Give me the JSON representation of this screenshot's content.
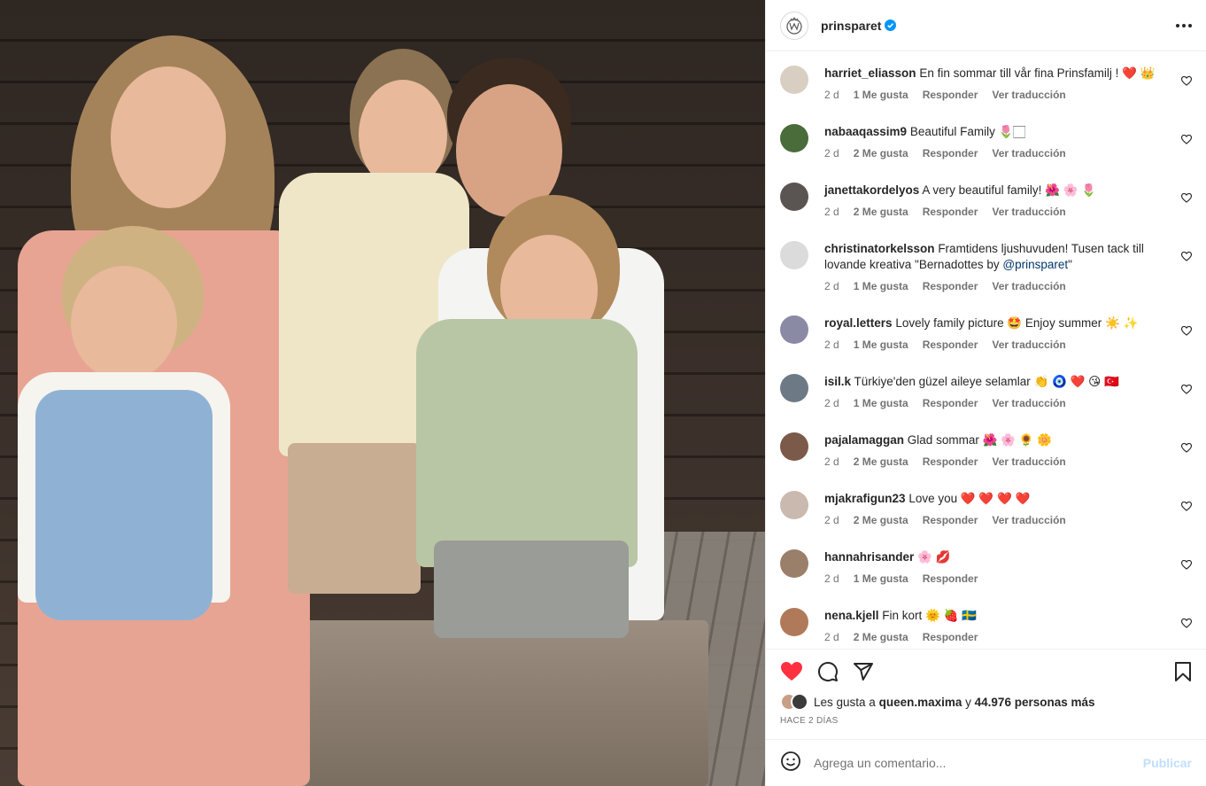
{
  "post": {
    "username": "prinsparet",
    "verified": true,
    "photo_alt": "Family photo"
  },
  "comments": [
    {
      "user": "harriet_eliasson",
      "text": "En fin sommar till vår fina Prinsfamilj ! ❤️ 👑",
      "age": "2 d",
      "likes": "1 Me gusta",
      "reply": "Responder",
      "translate": "Ver traducción",
      "avatar_color": "#d8cfc2"
    },
    {
      "user": "nabaaqassim9",
      "text": "Beautiful Family 🌷🏻",
      "age": "2 d",
      "likes": "2 Me gusta",
      "reply": "Responder",
      "translate": "Ver traducción",
      "avatar_color": "#4a6b3a"
    },
    {
      "user": "janettakordelyos",
      "text": "A very beautiful family! 🌺 🌸 🌷",
      "age": "2 d",
      "likes": "2 Me gusta",
      "reply": "Responder",
      "translate": "Ver traducción",
      "avatar_color": "#5a5552"
    },
    {
      "user": "christinatorkelsson",
      "text": "Framtidens ljushuvuden! Tusen tack till lovande kreativa \"Bernadottes by ",
      "mention": "@prinsparet",
      "text_end": "\"",
      "age": "2 d",
      "likes": "1 Me gusta",
      "reply": "Responder",
      "translate": "Ver traducción",
      "avatar_color": "#dbdbdb"
    },
    {
      "user": "royal.letters",
      "text": "Lovely family picture 🤩 Enjoy summer ☀️ ✨",
      "age": "2 d",
      "likes": "1 Me gusta",
      "reply": "Responder",
      "translate": "Ver traducción",
      "avatar_color": "#8a8aa5"
    },
    {
      "user": "isil.k",
      "text": "Türkiye'den güzel aileye selamlar 👏 🧿 ❤️ 😘 🇹🇷",
      "age": "2 d",
      "likes": "1 Me gusta",
      "reply": "Responder",
      "translate": "Ver traducción",
      "avatar_color": "#6d7a86"
    },
    {
      "user": "pajalamaggan",
      "text": "Glad sommar 🌺 🌸 🌻 🌼",
      "age": "2 d",
      "likes": "2 Me gusta",
      "reply": "Responder",
      "translate": "Ver traducción",
      "avatar_color": "#7b5a4a"
    },
    {
      "user": "mjakrafigun23",
      "text": "Love you ❤️ ❤️ ❤️ ❤️",
      "age": "2 d",
      "likes": "2 Me gusta",
      "reply": "Responder",
      "translate": "Ver traducción",
      "avatar_color": "#c9b9ae"
    },
    {
      "user": "hannahrisander",
      "text": "🌸 💋",
      "age": "2 d",
      "likes": "1 Me gusta",
      "reply": "Responder",
      "translate": "",
      "avatar_color": "#9a7f6b"
    },
    {
      "user": "nena.kjell",
      "text": "Fin kort 🌞 🍓 🇸🇪",
      "age": "2 d",
      "likes": "2 Me gusta",
      "reply": "Responder",
      "translate": "",
      "avatar_color": "#b07a5a"
    }
  ],
  "likes": {
    "prefix": "Les gusta a",
    "user": "queen.maxima",
    "joiner": "y",
    "count": "44.976 personas más"
  },
  "timestamp": "HACE 2 DÍAS",
  "add_comment": {
    "placeholder": "Agrega un comentario...",
    "post_label": "Publicar"
  },
  "colors": {
    "like_red": "#ff3040",
    "verified_blue": "#0095f6",
    "link_blue": "#00376b",
    "post_disabled": "#c0dffd"
  }
}
